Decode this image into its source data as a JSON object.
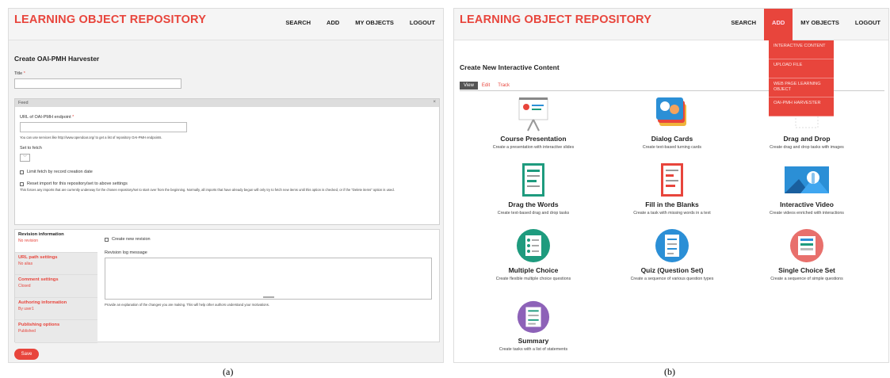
{
  "panel_a": {
    "logo": "LEARNING OBJECT REPOSITORY",
    "nav": [
      "SEARCH",
      "ADD",
      "MY OBJECTS",
      "LOGOUT"
    ],
    "page_title": "Create OAI-PMH Harvester",
    "title_label": "Title",
    "required_mark": "*",
    "feed": {
      "header": "Feed",
      "close": "×",
      "url_label": "URL of OAI-PMH endpoint",
      "url_help": "You can use services like http://www.opendoar.org/ to get a list of repository OAI-PMH endpoints.",
      "set_label": "Set to fetch",
      "set_value": "﹀",
      "limit_label": "Limit fetch by record creation date",
      "reset_label": "Reset import for this repository/set to above settings",
      "reset_help": "This forces any imports that are currently underway for the chosen repository/set to start over from the beginning. Normally, all imports that have already begun will only try to fetch new items until this option is checked, or if the \"Delete items\" option is used."
    },
    "vertical_tabs": [
      {
        "title": "Revision information",
        "sub": "No revision"
      },
      {
        "title": "URL path settings",
        "sub": "No alias"
      },
      {
        "title": "Comment settings",
        "sub": "Closed"
      },
      {
        "title": "Authoring information",
        "sub": "By user1"
      },
      {
        "title": "Publishing options",
        "sub": "Published"
      }
    ],
    "revision": {
      "create_label": "Create new revision",
      "log_label": "Revision log message",
      "log_help": "Provide an explanation of the changes you are making. This will help other authors understand your motivations."
    },
    "save": "Save",
    "caption": "(a)"
  },
  "panel_b": {
    "logo": "LEARNING OBJECT REPOSITORY",
    "nav": [
      "SEARCH",
      "ADD",
      "MY OBJECTS",
      "LOGOUT"
    ],
    "page_title": "Create New Interactive Content",
    "tabs": [
      "View",
      "Edit",
      "Track"
    ],
    "dropdown": [
      "INTERACTIVE CONTENT",
      "UPLOAD FILE",
      "WEB PAGE LEARNING OBJECT",
      "OAI-PMH HARVESTER"
    ],
    "cards": [
      {
        "name": "Course Presentation",
        "desc": "Create a presentation with interactive slides"
      },
      {
        "name": "Dialog Cards",
        "desc": "Create text-based turning cards"
      },
      {
        "name": "Drag and Drop",
        "desc": "Create drag and drop tasks with images"
      },
      {
        "name": "Drag the Words",
        "desc": "Create text-based drag and drop tasks"
      },
      {
        "name": "Fill in the Blanks",
        "desc": "Create a task with missing words in a text"
      },
      {
        "name": "Interactive Video",
        "desc": "Create videos enriched with interactions"
      },
      {
        "name": "Multiple Choice",
        "desc": "Create flexible multiple choice questions"
      },
      {
        "name": "Quiz (Question Set)",
        "desc": "Create a sequence of various question types"
      },
      {
        "name": "Single Choice Set",
        "desc": "Create a sequence of simple questions"
      },
      {
        "name": "Summary",
        "desc": "Create tasks with a list of statements"
      }
    ],
    "caption": "(b)"
  },
  "colors": {
    "accent": "#e8453c",
    "green": "#1e9b7e",
    "blue": "#2b8fd6",
    "pink": "#e8706c",
    "purple": "#8d62b8"
  }
}
